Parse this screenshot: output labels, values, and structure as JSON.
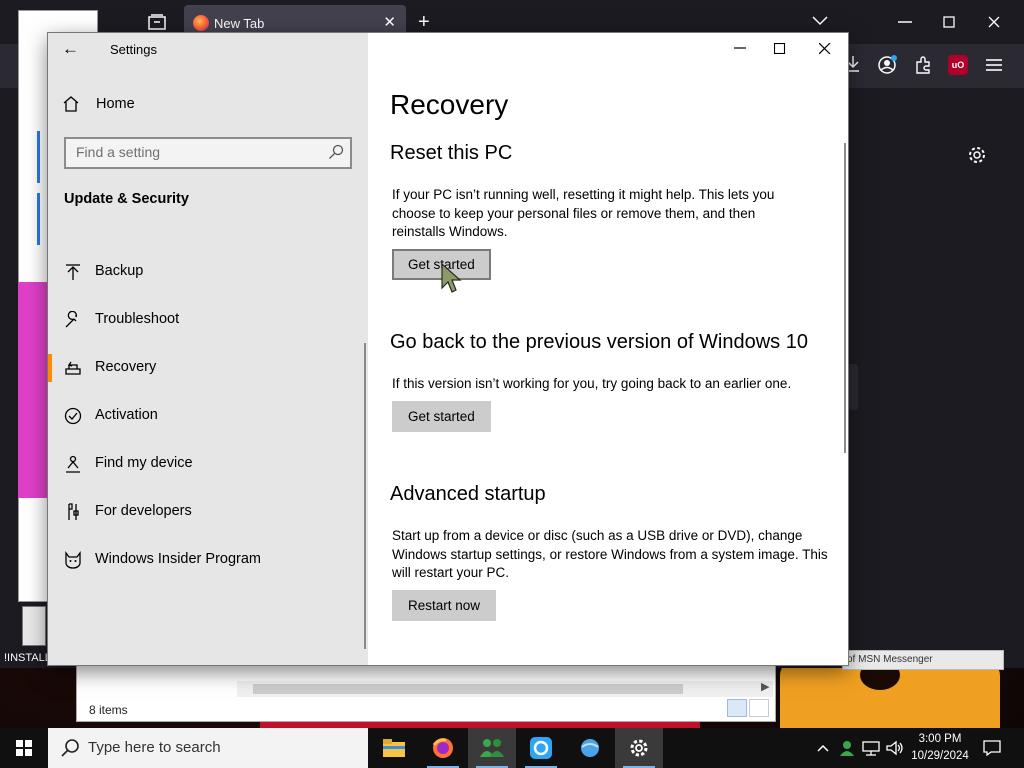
{
  "browser": {
    "tab_title": "New Tab",
    "tab_close": "✕",
    "new_tab": "+",
    "extension_badge": "uO"
  },
  "desktop": {
    "icon_label_installer": "!INSTALL"
  },
  "explorer": {
    "item_count": "8 items",
    "msn_text": "of MSN Messenger"
  },
  "settings": {
    "window_title": "Settings",
    "home_label": "Home",
    "search_placeholder": "Find a setting",
    "section_title": "Update & Security",
    "nav_items": [
      {
        "label": "Backup",
        "icon": "backup-icon"
      },
      {
        "label": "Troubleshoot",
        "icon": "wrench-icon"
      },
      {
        "label": "Recovery",
        "icon": "recovery-icon",
        "active": true
      },
      {
        "label": "Activation",
        "icon": "checkmark-circle-icon"
      },
      {
        "label": "Find my device",
        "icon": "person-pin-icon"
      },
      {
        "label": "For developers",
        "icon": "developer-tools-icon"
      },
      {
        "label": "Windows Insider Program",
        "icon": "insider-cat-icon"
      }
    ],
    "page_title": "Recovery",
    "sections": {
      "reset": {
        "heading": "Reset this PC",
        "text": "If your PC isn’t running well, resetting it might help. This lets you choose to keep your personal files or remove them, and then reinstalls Windows.",
        "button": "Get started"
      },
      "goback": {
        "heading": "Go back to the previous version of Windows 10",
        "text": "If this version isn’t working for you, try going back to an earlier one.",
        "button": "Get started"
      },
      "advanced": {
        "heading": "Advanced startup",
        "text": "Start up from a device or disc (such as a USB drive or DVD), change Windows startup settings, or restore Windows from a system image. This will restart your PC.",
        "button": "Restart now"
      }
    }
  },
  "taskbar": {
    "search_placeholder": "Type here to search",
    "time": "3:00 PM",
    "date": "10/29/2024",
    "pinned": [
      "file-explorer-icon",
      "firefox-icon",
      "msn-messenger-icon",
      "rustdesk-icon",
      "globe-app-icon",
      "settings-gear-icon"
    ]
  },
  "colors": {
    "accent": "#ff8c00",
    "nav_bg": "#e6e6e6",
    "button_bg": "#cccccc",
    "taskbar_bg": "#101010"
  }
}
